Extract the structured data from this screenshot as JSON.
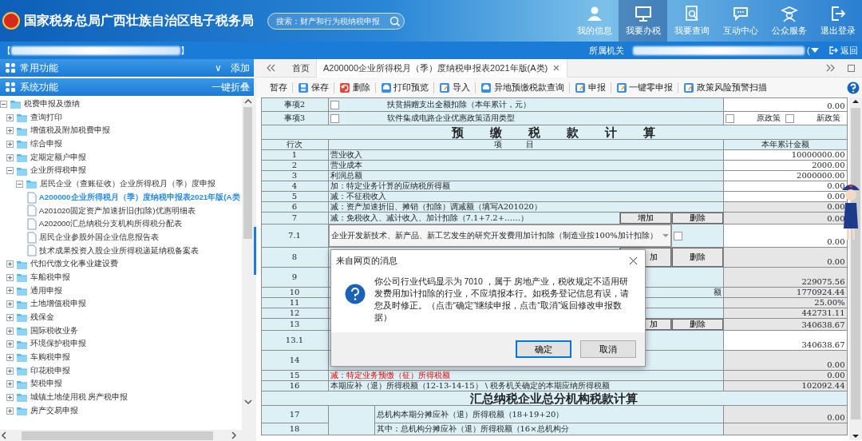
{
  "header": {
    "title": "国家税务总局广西壮族自治区电子税务局",
    "search": {
      "placeholder": "搜索：财产和行为税纳税申报"
    },
    "nav": [
      {
        "label": "我的信息",
        "selected": false
      },
      {
        "label": "我要办税",
        "selected": true
      },
      {
        "label": "我要查询",
        "selected": false
      },
      {
        "label": "互动中心",
        "selected": false
      },
      {
        "label": "公众服务",
        "selected": false
      },
      {
        "label": "退出登录",
        "selected": false
      }
    ]
  },
  "user_bar": {
    "open_bracket": "【",
    "close_bracket": "】",
    "office_label": "所属机关",
    "paren": "(",
    "back": "返回"
  },
  "sidebar": {
    "common": {
      "title": "常用功能",
      "toggle": "∨",
      "add": "添加"
    },
    "system": {
      "title": "系统功能",
      "collapse": "一键折叠"
    },
    "tree": [
      {
        "label": "税费申报及缴纳",
        "kind": "folder",
        "expanded": true,
        "selected": false,
        "children": [
          {
            "label": "查询打印",
            "kind": "folder",
            "expanded": false,
            "selected": false
          },
          {
            "label": "增值税及附加税费申报",
            "kind": "folder",
            "expanded": false,
            "selected": false
          },
          {
            "label": "综合申报",
            "kind": "folder",
            "expanded": false,
            "selected": false
          },
          {
            "label": "定期定额户申报",
            "kind": "folder",
            "expanded": false,
            "selected": false
          },
          {
            "label": "企业所得税申报",
            "kind": "folder",
            "expanded": true,
            "selected": false,
            "children": [
              {
                "label": "居民企业（查账征收）企业所得税月（季）度申报",
                "kind": "folder",
                "expanded": true,
                "selected": false,
                "children": [
                  {
                    "label": "A200000企业所得税月（季）度纳税申报表2021年版(A类",
                    "kind": "file",
                    "selected": true
                  },
                  {
                    "label": "A201020固定资产加速折旧(扣除)优惠明细表",
                    "kind": "file",
                    "selected": false
                  },
                  {
                    "label": "A202000汇总纳税分支机构所得税分配表",
                    "kind": "file",
                    "selected": false
                  },
                  {
                    "label": "居民企业参股外国企业信息报告表",
                    "kind": "file",
                    "selected": false
                  },
                  {
                    "label": "技术成果投资入股企业所得税递延纳税备案表",
                    "kind": "file",
                    "selected": false
                  }
                ]
              }
            ]
          },
          {
            "label": "代扣代缴文化事业建设费",
            "kind": "folder",
            "expanded": false,
            "selected": false
          },
          {
            "label": "车船税申报",
            "kind": "folder",
            "expanded": false,
            "selected": false
          },
          {
            "label": "通用申报",
            "kind": "folder",
            "expanded": false,
            "selected": false
          },
          {
            "label": "土地增值税申报",
            "kind": "folder",
            "expanded": false,
            "selected": false
          },
          {
            "label": "残保金",
            "kind": "folder",
            "expanded": false,
            "selected": false
          },
          {
            "label": "国际税收业务",
            "kind": "folder",
            "expanded": false,
            "selected": false
          },
          {
            "label": "环境保护税申报",
            "kind": "folder",
            "expanded": false,
            "selected": false
          },
          {
            "label": "车购税申报",
            "kind": "folder",
            "expanded": false,
            "selected": false
          },
          {
            "label": "印花税申报",
            "kind": "folder",
            "expanded": false,
            "selected": false
          },
          {
            "label": "契税申报",
            "kind": "folder",
            "expanded": false,
            "selected": false
          },
          {
            "label": "城镇土地使用税 房产税申报",
            "kind": "folder",
            "expanded": false,
            "selected": false
          },
          {
            "label": "房产交易申报",
            "kind": "folder",
            "expanded": false,
            "selected": false
          }
        ]
      }
    ]
  },
  "tabs": [
    {
      "label": "首页",
      "selected": false,
      "closable": false
    },
    {
      "label": "A200000企业所得税月（季）度纳税申报表2021年版(A类)",
      "selected": true,
      "closable": true
    }
  ],
  "toolbar": [
    "暂存",
    "保存",
    "删除",
    "打印预览",
    "导入",
    "异地预缴税款查询",
    "申报",
    "一键零申报",
    "政策风险预警扫描"
  ],
  "form": {
    "matters": [
      {
        "label": "事项2",
        "checked": false,
        "text": "扶贫捐赠支出全额扣除（本年累计，元）",
        "value": "0.00"
      },
      {
        "label": "事项3",
        "checked": false,
        "text": "软件集成电路企业优惠政策适用类型",
        "options": [
          {
            "label": "原政策",
            "checked": false
          },
          {
            "label": "新政策",
            "checked": false
          }
        ]
      }
    ],
    "section_title": "预缴税款计算",
    "columns": [
      "行次",
      "项目",
      "本年累计金额"
    ],
    "rows": [
      {
        "line": "1",
        "kind": "plain",
        "item": "营业收入",
        "amount": "10000000.00",
        "readonly": false
      },
      {
        "line": "2",
        "kind": "plain",
        "item": "营业成本",
        "amount": "2000.00",
        "readonly": false
      },
      {
        "line": "3",
        "kind": "plain",
        "item": "利润总额",
        "amount": "2000000.00",
        "readonly": false
      },
      {
        "line": "4",
        "kind": "plain",
        "item": "加：特定业务计算的应纳税所得额",
        "amount": "0.00",
        "readonly": false
      },
      {
        "line": "5",
        "kind": "plain",
        "item": "减：不征税收入",
        "amount": "0.00",
        "readonly": false
      },
      {
        "line": "6",
        "kind": "plain",
        "item": "减：资产加速折旧、摊销（扣除）调减额（填写A201020）",
        "amount": "0.00",
        "readonly": true
      },
      {
        "line": "7",
        "kind": "buttons",
        "item": "减：免税收入、减计收入、加计扣除（7.1+7.2+……）",
        "buttons": [
          "增加",
          "删除"
        ],
        "amount": "0.00",
        "readonly": true
      },
      {
        "line": "7.1",
        "kind": "select",
        "item": "企业开发新技术、新产品、新工艺发生的研究开发费用加计扣除（制造业按100%加计扣除）",
        "checked": false,
        "amount": "0.00",
        "readonly": false
      },
      {
        "line": "8",
        "kind": "covered_buttons",
        "buttons": [
          "加",
          "删除"
        ],
        "amount": "0.00",
        "readonly": true
      },
      {
        "line": "9",
        "kind": "covered",
        "amount": "229075.56",
        "readonly": true
      },
      {
        "line": "10",
        "kind": "covered",
        "item_tail": "额",
        "amount": "1770924.44",
        "readonly": true
      },
      {
        "line": "11",
        "kind": "covered",
        "amount": "25.00%",
        "readonly": true
      },
      {
        "line": "12",
        "kind": "covered",
        "amount": "442731.11",
        "readonly": true
      },
      {
        "line": "13",
        "kind": "covered_buttons",
        "buttons": [
          "加",
          "删除"
        ],
        "amount": "340638.67",
        "readonly": true
      },
      {
        "line": "13.1",
        "kind": "covered",
        "amount": "340638.67",
        "readonly": false
      },
      {
        "line": "14",
        "kind": "covered",
        "amount": "0.00",
        "readonly": true
      },
      {
        "line": "15",
        "kind": "plain",
        "item": "减：特定业务预缴（征）所得税额",
        "alert": true,
        "amount": "0.00",
        "readonly": true
      },
      {
        "line": "16",
        "kind": "plain",
        "item": "本期应补（退）所得税额（12-13-14-15） \\ 税务机关确定的本期应纳所得税额",
        "amount": "102092.44",
        "readonly": true
      }
    ],
    "section2_title": "汇总纳税企业总分机构税款计算",
    "rows2": [
      {
        "line": "17",
        "item": "总机构本期分摊应补（退）所得税额（18+19+20）",
        "amount": "0.00"
      },
      {
        "line": "18",
        "item": "其中：总机构分摊应补（退）所得税额（16×总机构分"
      }
    ]
  },
  "dialog": {
    "title": "来自网页的消息",
    "message": "你公司行业代码显示为 7010 ，属于 房地产业，税收规定不适用研发费用加计扣除的行业，不应填报本行。如税务登记信息有误，请您及时修正。（点击“确定”继续申报，点击“取消”返回修改申报数据）",
    "buttons": [
      {
        "label": "确定",
        "selected": true
      },
      {
        "label": "取消",
        "selected": false
      }
    ]
  }
}
